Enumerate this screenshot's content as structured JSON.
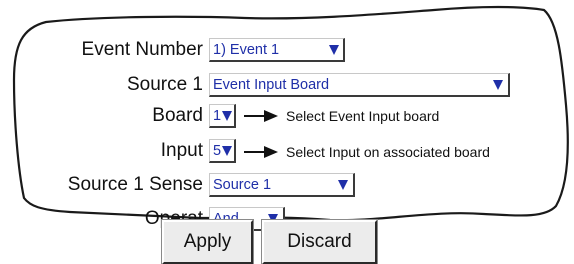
{
  "form": {
    "event_number": {
      "label": "Event Number",
      "value": "1) Event 1"
    },
    "source1": {
      "label": "Source 1",
      "value": "Event Input Board"
    },
    "board": {
      "label": "Board",
      "value": "1",
      "note": "Select Event Input board"
    },
    "input": {
      "label": "Input",
      "value": "5",
      "note": "Select Input on associated board"
    },
    "source1_sense": {
      "label": "Source 1 Sense",
      "value": "Source 1"
    },
    "operator": {
      "label": "Operat",
      "value": "And"
    }
  },
  "buttons": {
    "apply": "Apply",
    "discard": "Discard"
  },
  "colors": {
    "value_text": "#1f2fa8",
    "panel_bg": "#ffffff",
    "button_bg": "#ececec"
  }
}
